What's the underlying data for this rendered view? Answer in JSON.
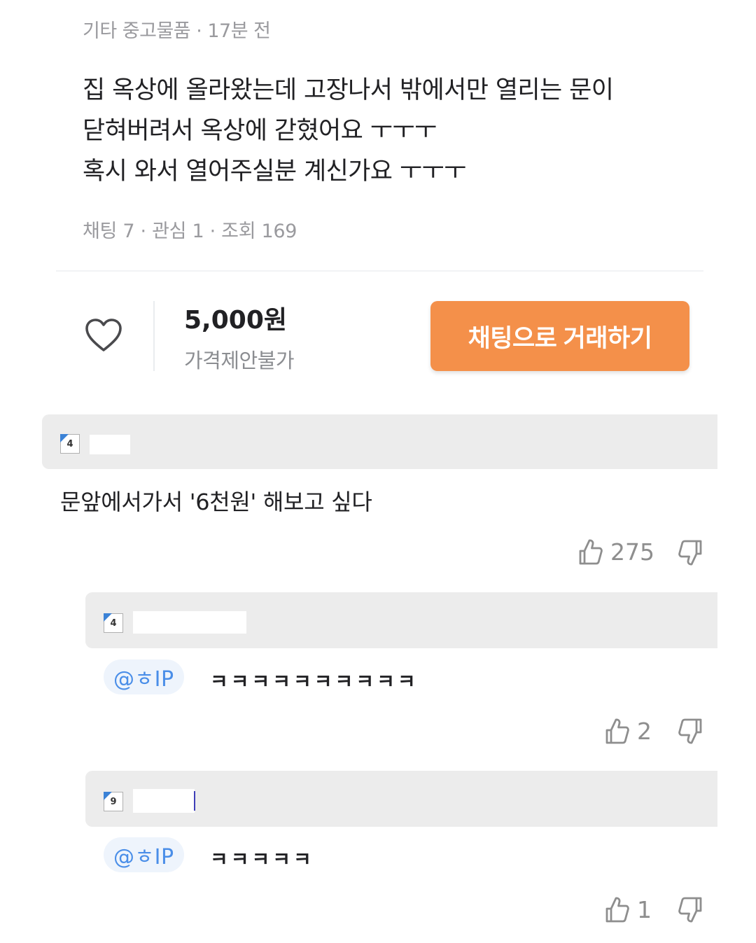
{
  "post": {
    "category_time": "기타 중고물품 · 17분 전",
    "body_lines": [
      "집 옥상에 올라왔는데 고장나서 밖에서만 열리는 문이",
      "닫혀버려서 옥상에 갇혔어요 ㅜㅜㅜ",
      "혹시 와서 열어주실분 계신가요 ㅜㅜㅜ"
    ],
    "stats": "채팅 7 · 관심 1 · 조회 169"
  },
  "buybar": {
    "price": "5,000원",
    "price_note": "가격제안불가",
    "chat_button": "채팅으로 거래하기"
  },
  "comments": [
    {
      "level": "4",
      "text": "문앞에서가서 '6천원' 해보고 싶다",
      "likes": "275"
    }
  ],
  "replies": [
    {
      "level": "4",
      "mention": "@ㅎIP",
      "text": "ㅋㅋㅋㅋㅋㅋㅋㅋㅋㅋ",
      "likes": "2"
    },
    {
      "level": "9",
      "mention": "@ㅎIP",
      "text": "ㅋㅋㅋㅋㅋ",
      "likes": "1"
    }
  ],
  "icons": {
    "heart": "heart-icon",
    "like": "thumbs-up-icon",
    "dislike": "thumbs-down-icon",
    "level": "level-badge-icon"
  },
  "colors": {
    "accent": "#f4904a",
    "mention": "#4a8ee8",
    "header_bg": "#ececec",
    "muted": "#9a9a9e"
  }
}
